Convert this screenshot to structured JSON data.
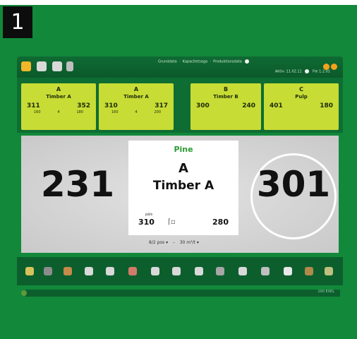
{
  "step_number": "1",
  "toolbar": {
    "links": [
      "Grunddata",
      "Kapacitetsaga",
      "Produktionsdata"
    ],
    "sub": "Aktiv: 11.02.11",
    "date": "Fre 1.2.01"
  },
  "cards": [
    {
      "letter": "A",
      "name": "Timber A",
      "left": "311",
      "right": "352",
      "sub_left": "160",
      "sub_mid": "4",
      "sub_right": "180"
    },
    {
      "letter": "A",
      "name": "Timber A",
      "left": "310",
      "right": "317",
      "sub_left": "160",
      "sub_mid": "4",
      "sub_right": "200"
    },
    {
      "letter": "B",
      "name": "Timber B",
      "left": "300",
      "right": "240"
    },
    {
      "letter": "C",
      "name": "Pulp",
      "left": "401",
      "right": "180"
    }
  ],
  "main": {
    "left_value": "231",
    "right_value": "301",
    "wood_type": "Pine",
    "center_letter": "A",
    "center_name": "Timber A",
    "small_label": "päls",
    "n1": "310",
    "n2": "280",
    "select_left": "8/2 pos",
    "select_right": "30 m³/t"
  },
  "status": {
    "right": "100   EXEL"
  },
  "colors": {
    "page_bg": "#12883a",
    "card": "#c7dc35",
    "wood": "#2e9a36"
  }
}
